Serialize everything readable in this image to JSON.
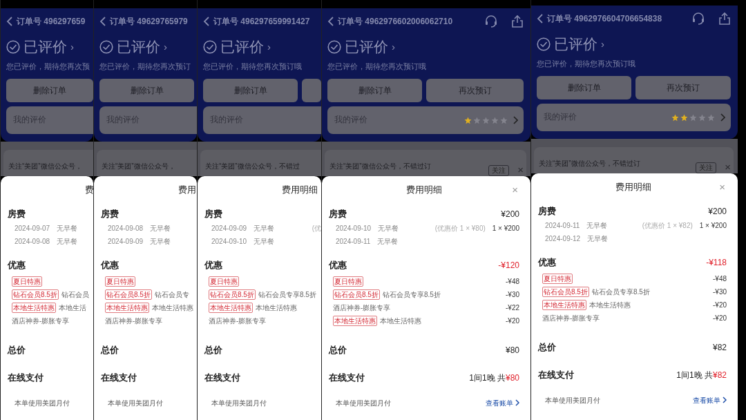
{
  "panels": [
    {
      "order": "订单号 496297659",
      "status": "已评价",
      "status_arrow": "›",
      "subtitle": "您已评价，期待您再次预",
      "buttons": [
        {
          "kind": "full",
          "label": "删除订单"
        }
      ],
      "review": {
        "label": "我的评价"
      },
      "notice": {
        "text": "关注“美团”微信公众号，"
      },
      "sheet": {
        "title": "费",
        "sections": [
          {
            "kind": "room",
            "title": "房费",
            "lines": [
              {
                "date": "2024-09-07",
                "meal": "无早餐"
              },
              {
                "date": "2024-09-08",
                "meal": "无早餐"
              }
            ]
          },
          {
            "kind": "discount",
            "title": "优惠",
            "items": [
              {
                "tag": "夏日特惠"
              },
              {
                "tag": "钻石会员8.5折",
                "text": "钻石会员"
              },
              {
                "tag": "本地生活特惠",
                "text": "本地生活"
              },
              {
                "text": "酒店神券-膨胀专享"
              }
            ]
          },
          {
            "kind": "total",
            "title": "总价"
          },
          {
            "kind": "payment",
            "title": "在线支付",
            "note": "本单使用美团月付"
          }
        ]
      }
    },
    {
      "order": "订单号 49629765979",
      "status": "已评价",
      "status_arrow": "›",
      "subtitle": "您已评价，期待您再次预订",
      "buttons": [
        {
          "kind": "full",
          "label": "删除订单"
        }
      ],
      "review": {
        "label": "我的评价"
      },
      "notice": {
        "text": "关注“美团”微信公众号，"
      },
      "sheet": {
        "title": "费用",
        "sections": [
          {
            "kind": "room",
            "title": "房费",
            "lines": [
              {
                "date": "2024-09-08",
                "meal": "无早餐"
              },
              {
                "date": "2024-09-09",
                "meal": "无早餐"
              }
            ]
          },
          {
            "kind": "discount",
            "title": "优惠",
            "items": [
              {
                "tag": "夏日特惠"
              },
              {
                "tag": "钻石会员8.5折",
                "text": "钻石会员专"
              },
              {
                "tag": "本地生活特惠",
                "text": "本地生活特惠"
              },
              {
                "text": "酒店神券-膨胀专享"
              }
            ]
          },
          {
            "kind": "total",
            "title": "总价"
          },
          {
            "kind": "payment",
            "title": "在线支付",
            "note": "本单使用美团月付"
          }
        ]
      }
    },
    {
      "order": "订单号 496297659991427",
      "status": "已评价",
      "status_arrow": "›",
      "subtitle": "您已评价，期待您再次预订哦",
      "buttons": [
        {
          "kind": "full",
          "label": "删除订单"
        },
        {
          "kind": "cut"
        }
      ],
      "review": {
        "label": "我的评价"
      },
      "notice": {
        "text": "关注“美团”微信公众号，不错过"
      },
      "sheet": {
        "title": "费用明细",
        "sections": [
          {
            "kind": "room",
            "title": "房费",
            "lines": [
              {
                "date": "2024-09-09",
                "meal": "无早餐",
                "note": "(优"
              },
              {
                "date": "2024-09-10",
                "meal": "无早餐"
              }
            ]
          },
          {
            "kind": "discount",
            "title": "优惠",
            "items": [
              {
                "tag": "夏日特惠"
              },
              {
                "tag": "钻石会员8.5折",
                "text": "钻石会员专享8.5折"
              },
              {
                "tag": "本地生活特惠",
                "text": "本地生活特惠"
              },
              {
                "text": "酒店神券-膨胀专享"
              }
            ]
          },
          {
            "kind": "total",
            "title": "总价"
          },
          {
            "kind": "payment",
            "title": "在线支付",
            "note": "本单使用美团月付"
          }
        ]
      }
    },
    {
      "order": "订单号 4962976602006062710",
      "header_icons": true,
      "status": "已评价",
      "status_arrow": "›",
      "subtitle": "您已评价，期待您再次预订哦",
      "buttons": [
        {
          "kind": "full",
          "label": "删除订单"
        },
        {
          "kind": "full",
          "label": "再次预订"
        }
      ],
      "review": {
        "label": "我的评价",
        "stars": 1
      },
      "notice": {
        "text": "关注“美团”微信公众号，不错过订",
        "follow": "关注",
        "close": "×"
      },
      "sheet": {
        "title": "费用明细",
        "close": "×",
        "sections": [
          {
            "kind": "room",
            "title": "房费",
            "amount": "¥200",
            "lines": [
              {
                "date": "2024-09-10",
                "meal": "无早餐",
                "note": "(优惠价 1 × ¥80)",
                "price": "1 × ¥200"
              },
              {
                "date": "2024-09-11",
                "meal": "无早餐"
              }
            ]
          },
          {
            "kind": "discount",
            "title": "优惠",
            "amount": "-¥120",
            "items": [
              {
                "tag": "夏日特惠",
                "amount": "-¥48"
              },
              {
                "tag": "钻石会员8.5折",
                "text": "钻石会员专享8.5折",
                "amount": "-¥30"
              },
              {
                "text": "酒店神券-膨胀专享",
                "amount": "-¥22"
              },
              {
                "tag": "本地生活特惠",
                "text": "本地生活特惠",
                "amount": "-¥20"
              }
            ]
          },
          {
            "kind": "total",
            "title": "总价",
            "amount": "¥80"
          },
          {
            "kind": "payment",
            "title": "在线支付",
            "summary": "1间1晚 共",
            "amount": "¥80",
            "note": "本单使用美团月付",
            "link": "查看账单"
          }
        ]
      }
    },
    {
      "order": "订单号 4962976604706654838",
      "header_icons": true,
      "status": "已评价",
      "status_arrow": "›",
      "subtitle": "您已评价，期待您再次预订哦",
      "buttons": [
        {
          "kind": "full",
          "label": "删除订单"
        },
        {
          "kind": "full",
          "label": "再次预订"
        }
      ],
      "review": {
        "label": "我的评价",
        "stars": 2
      },
      "notice": {
        "text": "关注“美团”微信公众号，不错过订",
        "follow": "关注",
        "close": "×"
      },
      "sheet": {
        "title": "费用明细",
        "close": "×",
        "sections": [
          {
            "kind": "room",
            "title": "房费",
            "amount": "¥200",
            "lines": [
              {
                "date": "2024-09-11",
                "meal": "无早餐",
                "note": "(优惠价 1 × ¥82)",
                "price": "1 × ¥200"
              },
              {
                "date": "2024-09-12",
                "meal": "无早餐"
              }
            ]
          },
          {
            "kind": "discount",
            "title": "优惠",
            "amount": "-¥118",
            "items": [
              {
                "tag": "夏日特惠",
                "amount": "-¥48"
              },
              {
                "tag": "钻石会员8.5折",
                "text": "钻石会员专享8.5折",
                "amount": "-¥30"
              },
              {
                "tag": "本地生活特惠",
                "text": "本地生活特惠",
                "amount": "-¥20"
              },
              {
                "text": "酒店神券-膨胀专享",
                "amount": "-¥20"
              }
            ]
          },
          {
            "kind": "total",
            "title": "总价",
            "amount": "¥82"
          },
          {
            "kind": "payment",
            "title": "在线支付",
            "summary": "1间1晚 共",
            "amount": "¥82",
            "note": "本单使用美团月付",
            "link": "查看账单"
          }
        ]
      }
    }
  ]
}
